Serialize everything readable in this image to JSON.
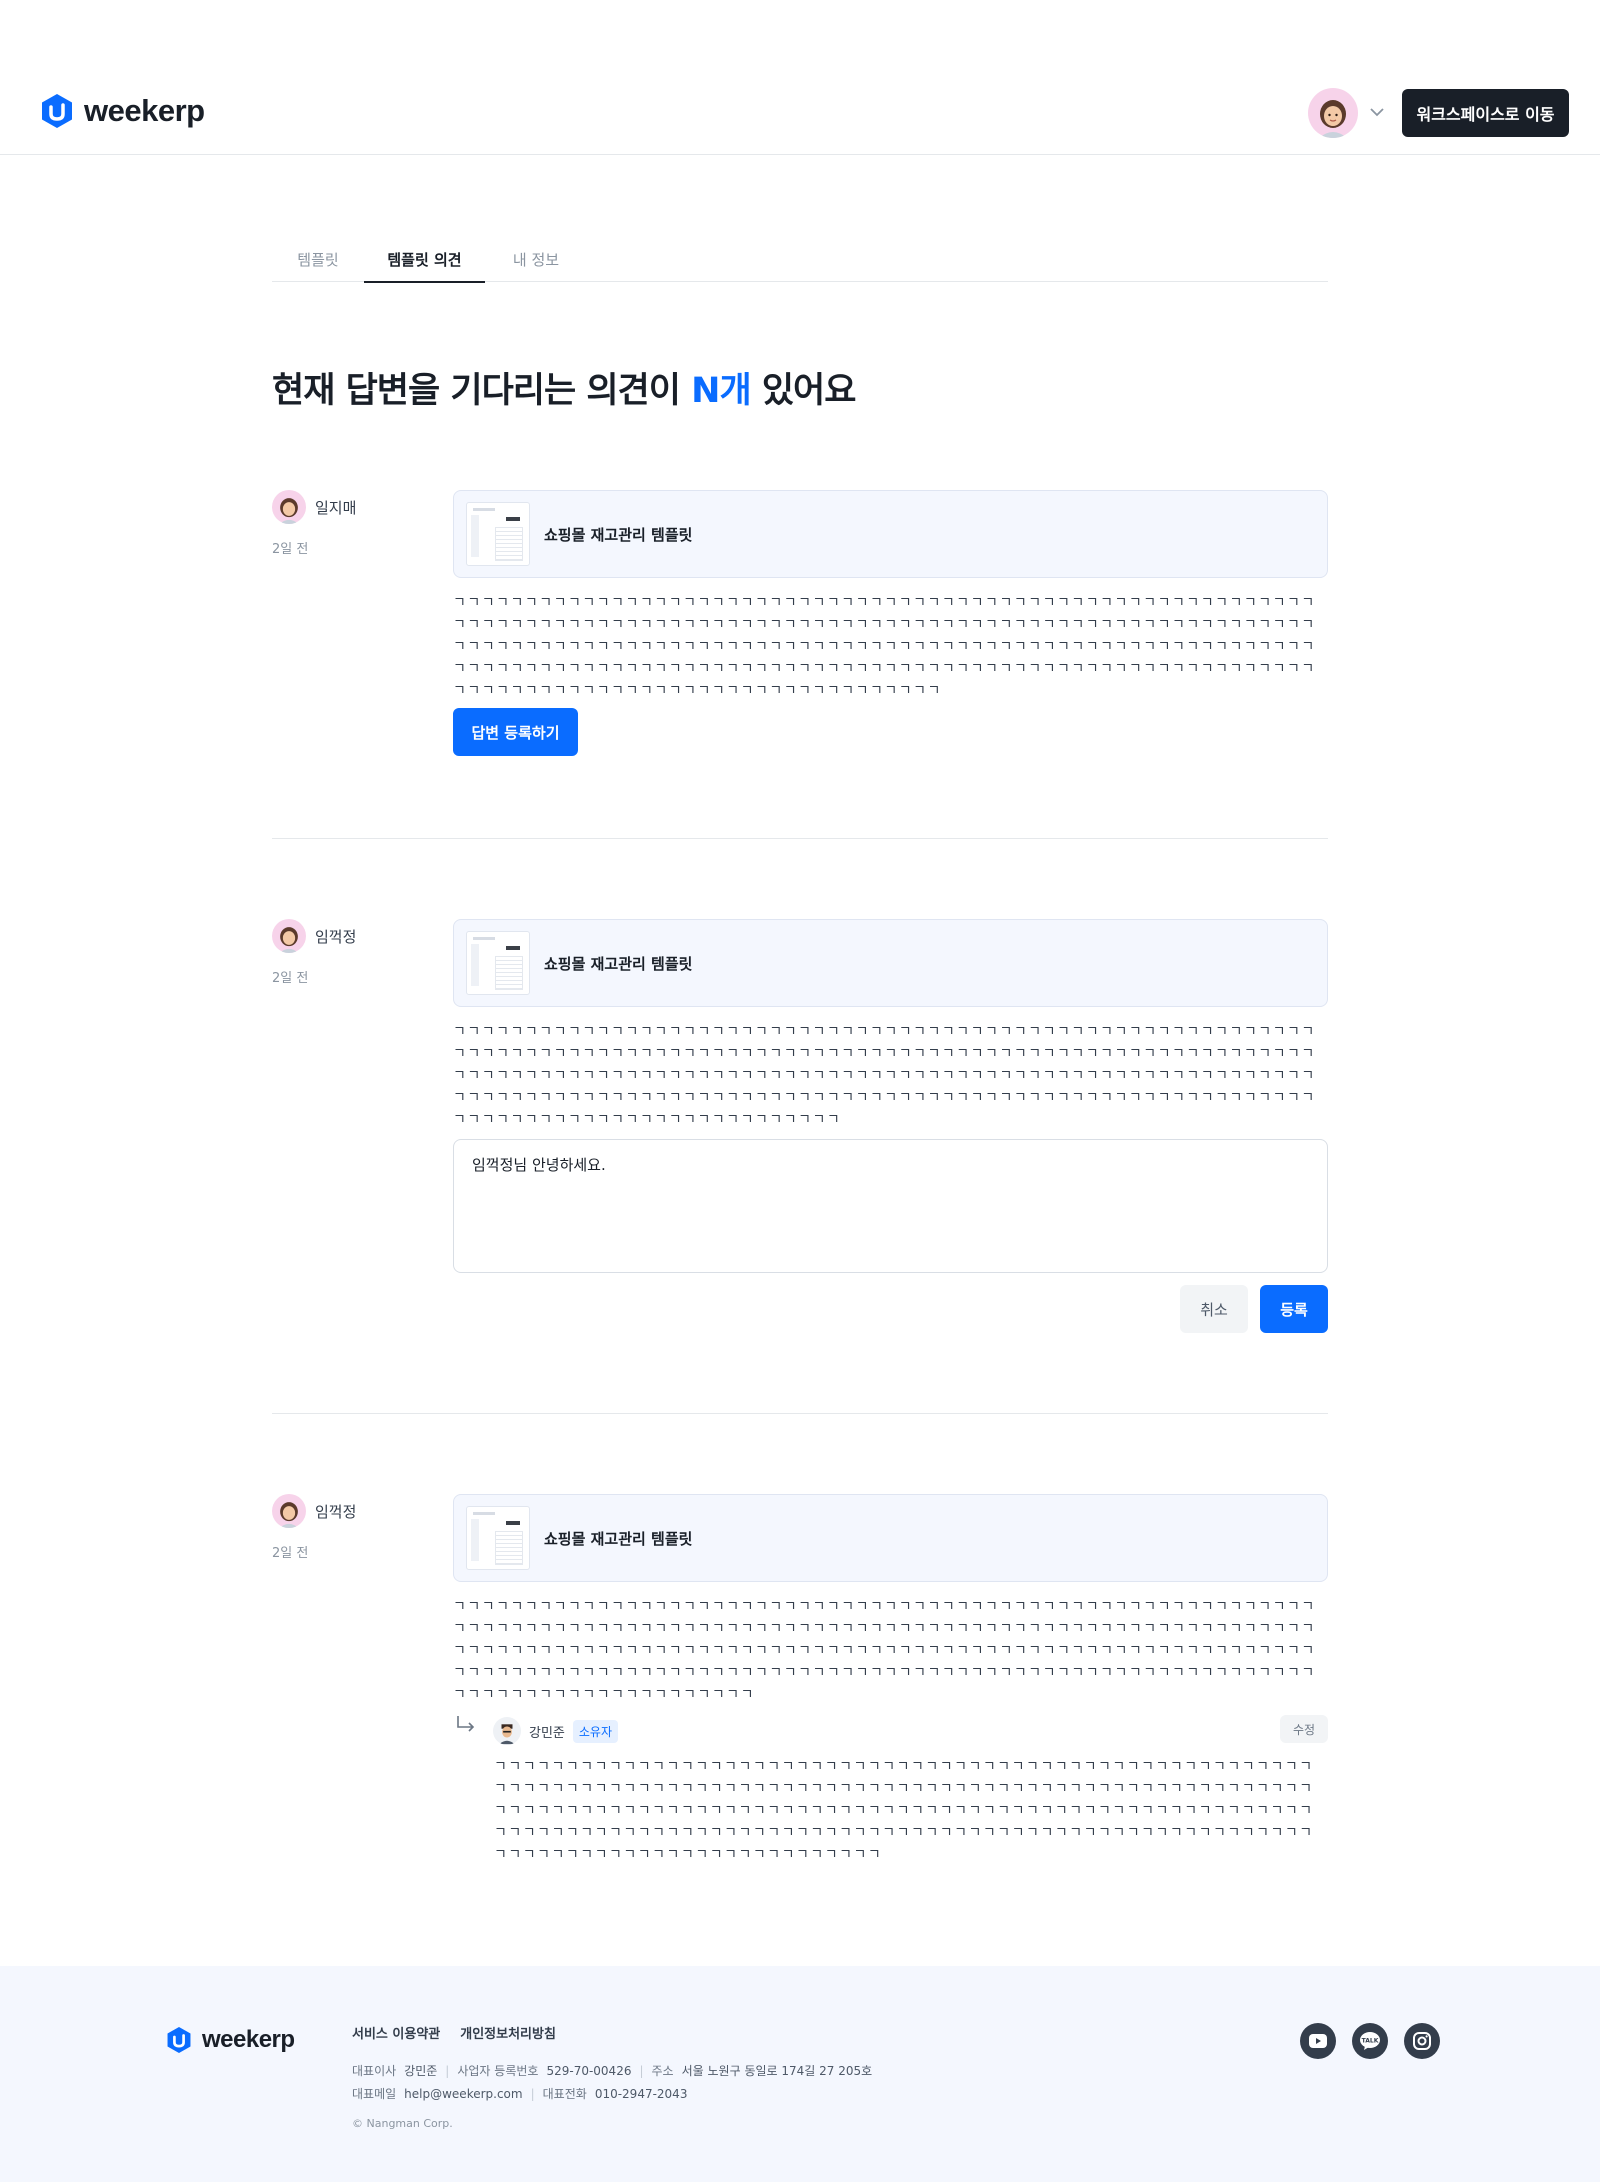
{
  "header": {
    "logo_text": "weekerp",
    "workspace_button": "워크스페이스로 이동",
    "brand_color": "#0a6cff"
  },
  "tabs": [
    {
      "label": "템플릿",
      "active": false
    },
    {
      "label": "템플릿 의견",
      "active": true
    },
    {
      "label": "내 정보",
      "active": false
    }
  ],
  "headline": {
    "prefix": "현재 답변을 기다리는 의견이 ",
    "count": "N개",
    "suffix": " 있어요"
  },
  "opinions": [
    {
      "author": "일지매",
      "time": "2일 전",
      "template_title": "쇼핑몰 재고관리 템플릿",
      "text": "ㄱㄱㄱㄱㄱㄱㄱㄱㄱㄱㄱㄱㄱㄱㄱㄱㄱㄱㄱㄱㄱㄱㄱㄱㄱㄱㄱㄱㄱㄱㄱㄱㄱㄱㄱㄱㄱㄱㄱㄱㄱㄱㄱㄱㄱㄱㄱㄱㄱㄱㄱㄱㄱㄱㄱㄱㄱㄱㄱㄱㄱㄱㄱㄱㄱㄱㄱㄱㄱㄱㄱㄱㄱㄱㄱㄱㄱㄱㄱㄱㄱㄱㄱㄱㄱㄱㄱㄱㄱㄱㄱㄱㄱㄱㄱㄱㄱㄱㄱㄱㄱㄱㄱㄱㄱㄱㄱㄱㄱㄱㄱㄱㄱㄱㄱㄱㄱㄱㄱㄱㄱㄱㄱㄱㄱㄱㄱㄱㄱㄱㄱㄱㄱㄱㄱㄱㄱㄱㄱㄱㄱㄱㄱㄱㄱㄱㄱㄱㄱㄱㄱㄱㄱㄱㄱㄱㄱㄱㄱㄱㄱㄱㄱㄱㄱㄱㄱㄱㄱㄱㄱㄱㄱㄱㄱㄱㄱㄱㄱㄱㄱㄱㄱㄱㄱㄱㄱㄱㄱㄱㄱㄱㄱㄱㄱㄱㄱㄱㄱㄱㄱㄱㄱㄱㄱㄱㄱㄱㄱㄱㄱㄱㄱㄱㄱㄱㄱㄱㄱㄱㄱㄱㄱㄱㄱㄱㄱㄱㄱㄱㄱㄱㄱㄱㄱㄱㄱㄱㄱㄱㄱㄱㄱㄱㄱㄱㄱㄱㄱㄱㄱㄱㄱㄱㄱㄱㄱㄱㄱㄱㄱㄱㄱㄱㄱㄱㄱㄱㄱㄱㄱㄱㄱㄱ",
      "reply_button": "답변 등록하기"
    },
    {
      "author": "임꺽정",
      "time": "2일 전",
      "template_title": "쇼핑몰 재고관리 템플릿",
      "text": "ㄱㄱㄱㄱㄱㄱㄱㄱㄱㄱㄱㄱㄱㄱㄱㄱㄱㄱㄱㄱㄱㄱㄱㄱㄱㄱㄱㄱㄱㄱㄱㄱㄱㄱㄱㄱㄱㄱㄱㄱㄱㄱㄱㄱㄱㄱㄱㄱㄱㄱㄱㄱㄱㄱㄱㄱㄱㄱㄱㄱㄱㄱㄱㄱㄱㄱㄱㄱㄱㄱㄱㄱㄱㄱㄱㄱㄱㄱㄱㄱㄱㄱㄱㄱㄱㄱㄱㄱㄱㄱㄱㄱㄱㄱㄱㄱㄱㄱㄱㄱㄱㄱㄱㄱㄱㄱㄱㄱㄱㄱㄱㄱㄱㄱㄱㄱㄱㄱㄱㄱㄱㄱㄱㄱㄱㄱㄱㄱㄱㄱㄱㄱㄱㄱㄱㄱㄱㄱㄱㄱㄱㄱㄱㄱㄱㄱㄱㄱㄱㄱㄱㄱㄱㄱㄱㄱㄱㄱㄱㄱㄱㄱㄱㄱㄱㄱㄱㄱㄱㄱㄱㄱㄱㄱㄱㄱㄱㄱㄱㄱㄱㄱㄱㄱㄱㄱㄱㄱㄱㄱㄱㄱㄱㄱㄱㄱㄱㄱㄱㄱㄱㄱㄱㄱㄱㄱㄱㄱㄱㄱㄱㄱㄱㄱㄱㄱㄱㄱㄱㄱㄱㄱㄱㄱㄱㄱㄱㄱㄱㄱㄱㄱㄱㄱㄱㄱㄱㄱㄱㄱㄱㄱㄱㄱㄱㄱㄱㄱㄱㄱㄱㄱㄱㄱㄱㄱㄱㄱㄱㄱㄱㄱㄱㄱㄱㄱㄱ",
      "reply_draft": "임꺽정님 안녕하세요.",
      "cancel_button": "취소",
      "submit_button": "등록"
    },
    {
      "author": "임꺽정",
      "time": "2일 전",
      "template_title": "쇼핑몰 재고관리 템플릿",
      "text": "ㄱㄱㄱㄱㄱㄱㄱㄱㄱㄱㄱㄱㄱㄱㄱㄱㄱㄱㄱㄱㄱㄱㄱㄱㄱㄱㄱㄱㄱㄱㄱㄱㄱㄱㄱㄱㄱㄱㄱㄱㄱㄱㄱㄱㄱㄱㄱㄱㄱㄱㄱㄱㄱㄱㄱㄱㄱㄱㄱㄱㄱㄱㄱㄱㄱㄱㄱㄱㄱㄱㄱㄱㄱㄱㄱㄱㄱㄱㄱㄱㄱㄱㄱㄱㄱㄱㄱㄱㄱㄱㄱㄱㄱㄱㄱㄱㄱㄱㄱㄱㄱㄱㄱㄱㄱㄱㄱㄱㄱㄱㄱㄱㄱㄱㄱㄱㄱㄱㄱㄱㄱㄱㄱㄱㄱㄱㄱㄱㄱㄱㄱㄱㄱㄱㄱㄱㄱㄱㄱㄱㄱㄱㄱㄱㄱㄱㄱㄱㄱㄱㄱㄱㄱㄱㄱㄱㄱㄱㄱㄱㄱㄱㄱㄱㄱㄱㄱㄱㄱㄱㄱㄱㄱㄱㄱㄱㄱㄱㄱㄱㄱㄱㄱㄱㄱㄱㄱㄱㄱㄱㄱㄱㄱㄱㄱㄱㄱㄱㄱㄱㄱㄱㄱㄱㄱㄱㄱㄱㄱㄱㄱㄱㄱㄱㄱㄱㄱㄱㄱㄱㄱㄱㄱㄱㄱㄱㄱㄱㄱㄱㄱㄱㄱㄱㄱㄱㄱㄱㄱㄱㄱㄱㄱㄱㄱㄱㄱㄱㄱㄱㄱㄱㄱㄱㄱㄱㄱㄱㄱㄱㄱ",
      "answer": {
        "author": "강민준",
        "badge": "소유자",
        "edit_button": "수정",
        "text": "ㄱㄱㄱㄱㄱㄱㄱㄱㄱㄱㄱㄱㄱㄱㄱㄱㄱㄱㄱㄱㄱㄱㄱㄱㄱㄱㄱㄱㄱㄱㄱㄱㄱㄱㄱㄱㄱㄱㄱㄱㄱㄱㄱㄱㄱㄱㄱㄱㄱㄱㄱㄱㄱㄱㄱㄱㄱㄱㄱㄱㄱㄱㄱㄱㄱㄱㄱㄱㄱㄱㄱㄱㄱㄱㄱㄱㄱㄱㄱㄱㄱㄱㄱㄱㄱㄱㄱㄱㄱㄱㄱㄱㄱㄱㄱㄱㄱㄱㄱㄱㄱㄱㄱㄱㄱㄱㄱㄱㄱㄱㄱㄱㄱㄱㄱㄱㄱㄱㄱㄱㄱㄱㄱㄱㄱㄱㄱㄱㄱㄱㄱㄱㄱㄱㄱㄱㄱㄱㄱㄱㄱㄱㄱㄱㄱㄱㄱㄱㄱㄱㄱㄱㄱㄱㄱㄱㄱㄱㄱㄱㄱㄱㄱㄱㄱㄱㄱㄱㄱㄱㄱㄱㄱㄱㄱㄱㄱㄱㄱㄱㄱㄱㄱㄱㄱㄱㄱㄱㄱㄱㄱㄱㄱㄱㄱㄱㄱㄱㄱㄱㄱㄱㄱㄱㄱㄱㄱㄱㄱㄱㄱㄱㄱㄱㄱㄱㄱㄱㄱㄱㄱㄱㄱㄱㄱㄱㄱㄱㄱㄱㄱㄱㄱㄱㄱㄱㄱㄱㄱㄱㄱㄱㄱㄱㄱㄱㄱㄱㄱㄱㄱㄱㄱㄱㄱ"
      }
    }
  ],
  "footer": {
    "logo_text": "weekerp",
    "links": [
      "서비스 이용약관",
      "개인정보처리방침"
    ],
    "ceo_label": "대표이사",
    "ceo": "강민준",
    "biz_label": "사업자 등록번호",
    "biz_no": "529-70-00426",
    "addr_label": "주소",
    "address": "서울 노원구 동일로 174길 27 205호",
    "email_label": "대표메일",
    "email": "help@weekerp.com",
    "phone_label": "대표전화",
    "phone": "010-2947-2043",
    "copyright": "© Nangman Corp.",
    "social_icons": [
      "youtube-icon",
      "kakaotalk-icon",
      "instagram-icon"
    ],
    "kakao_label": "TALK"
  }
}
